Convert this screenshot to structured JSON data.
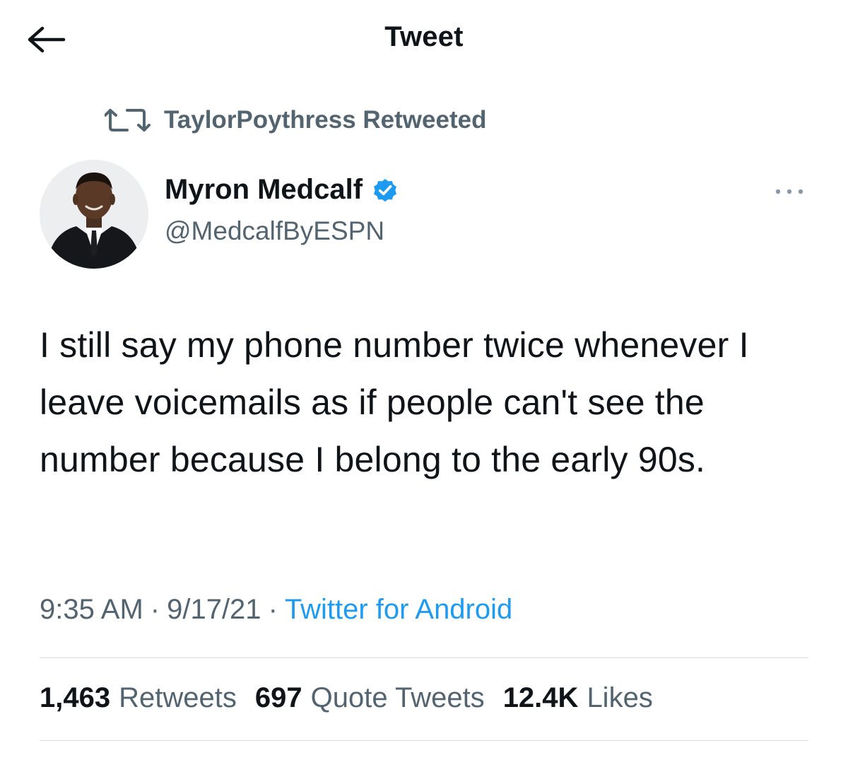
{
  "header": {
    "title": "Tweet",
    "back_icon": "arrow-left-icon"
  },
  "retweet_context": {
    "text": "TaylorPoythress Retweeted",
    "icon": "retweet-icon"
  },
  "author": {
    "name": "Myron Medcalf",
    "handle": "@MedcalfByESPN",
    "verified": true,
    "verified_icon": "verified-badge-icon",
    "avatar_icon": "avatar-photo"
  },
  "more_icon": "more-dots-icon",
  "tweet": {
    "text": "I still say my phone number twice whenever I leave voicemails as if people can't see the number because I belong to the early 90s."
  },
  "meta": {
    "time": "9:35 AM",
    "date": "9/17/21",
    "separator": "·",
    "source": "Twitter for Android"
  },
  "stats": {
    "retweets_count": "1,463",
    "retweets_label": "Retweets",
    "quotes_count": "697",
    "quotes_label": "Quote Tweets",
    "likes_count": "12.4K",
    "likes_label": "Likes"
  },
  "colors": {
    "text_primary": "#0f1419",
    "text_secondary": "#536471",
    "accent": "#1d9bf0",
    "divider": "#d9dde0"
  }
}
